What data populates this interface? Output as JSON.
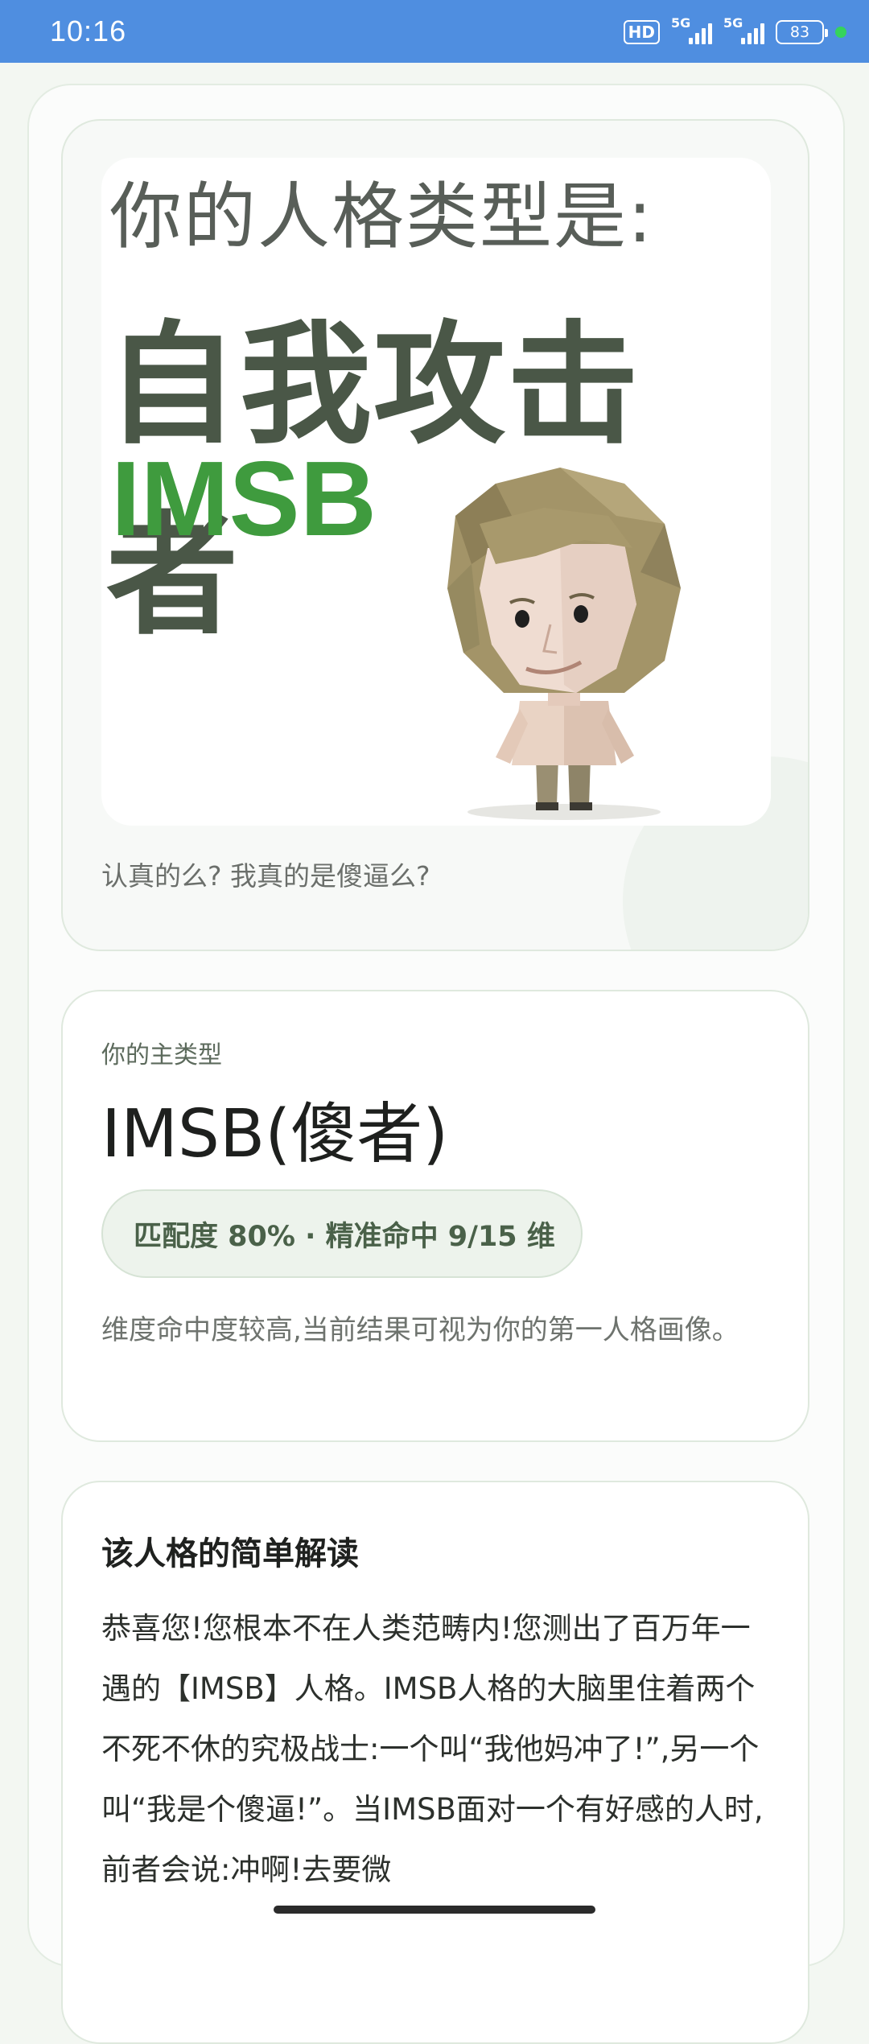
{
  "status_bar": {
    "time": "10:16",
    "hd": "HD",
    "network1": "5G",
    "network2": "5G",
    "battery": "83"
  },
  "result_card": {
    "image_line1": "你的人格类型是:",
    "image_line2": "自我攻击者",
    "image_line3": "IMSB",
    "caption": "认真的么? 我真的是傻逼么?"
  },
  "main_type_card": {
    "kicker": "你的主类型",
    "title": "IMSB(傻者)",
    "pill": "匹配度 80% · 精准命中 9/15 维",
    "description": "维度命中度较高,当前结果可视为你的第一人格画像。"
  },
  "interpretation_card": {
    "heading": "该人格的简单解读",
    "body": "恭喜您!您根本不在人类范畴内!您测出了百万年一遇的【IMSB】人格。IMSB人格的大脑里住着两个不死不休的究极战士:一个叫“我他妈冲了!”,另一个叫“我是个傻逼!”。当IMSB面对一个有好感的人时,前者会说:冲啊!去要微"
  },
  "colors": {
    "status_bar": "#4f8ee0",
    "accent_green": "#3f9b3e",
    "title_dark_green": "#4a5747"
  }
}
